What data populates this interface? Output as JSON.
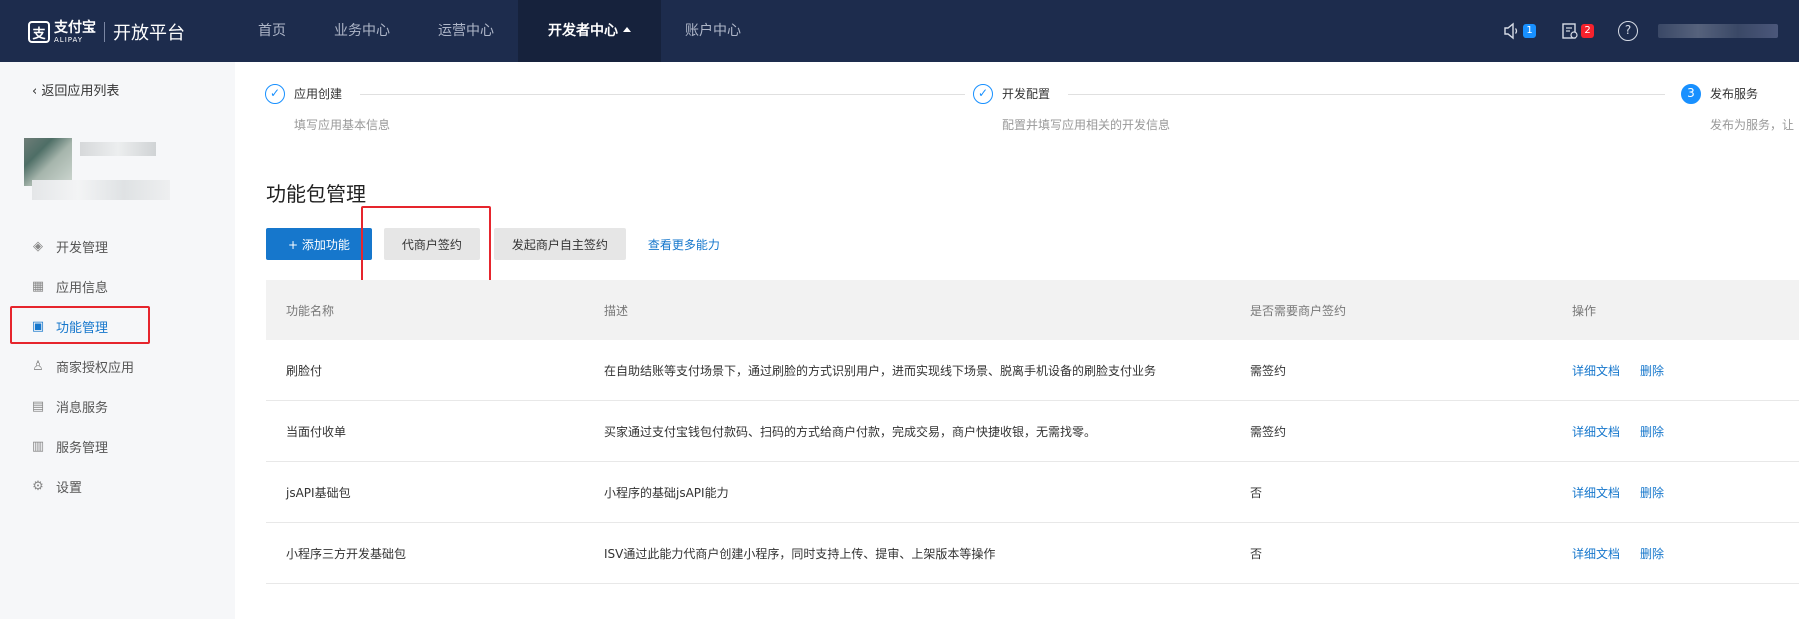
{
  "topbar": {
    "logo_mark": "支",
    "logo_cn": "支付宝",
    "logo_en": "ALIPAY",
    "platform_title": "开放平台",
    "nav": [
      {
        "label": "首页"
      },
      {
        "label": "业务中心"
      },
      {
        "label": "运营中心"
      },
      {
        "label": "开发者中心"
      },
      {
        "label": "账户中心"
      }
    ],
    "notifications_count": "1",
    "messages_count": "2",
    "help_glyph": "?"
  },
  "sidebar": {
    "back_label": "返回应用列表",
    "menu": [
      {
        "label": "开发管理",
        "icon": "layers-icon"
      },
      {
        "label": "应用信息",
        "icon": "grid-icon"
      },
      {
        "label": "功能管理",
        "icon": "package-icon"
      },
      {
        "label": "商家授权应用",
        "icon": "user-icon"
      },
      {
        "label": "消息服务",
        "icon": "chart-icon"
      },
      {
        "label": "服务管理",
        "icon": "service-icon"
      },
      {
        "label": "设置",
        "icon": "gear-icon"
      }
    ]
  },
  "steps": [
    {
      "title": "应用创建",
      "desc": "填写应用基本信息",
      "status": "done"
    },
    {
      "title": "开发配置",
      "desc": "配置并填写应用相关的开发信息",
      "status": "done"
    },
    {
      "number": "3",
      "title": "发布服务",
      "desc": "发布为服务，让",
      "status": "current"
    }
  ],
  "page_title": "功能包管理",
  "actions": {
    "add_label": "+ 添加功能",
    "proxy_sign_label": "代商户签约",
    "self_sign_label": "发起商户自主签约",
    "more_label": "查看更多能力"
  },
  "table": {
    "headers": [
      "功能名称",
      "描述",
      "是否需要商户签约",
      "操作"
    ],
    "rows": [
      {
        "name": "刷脸付",
        "desc": "在自助结账等支付场景下，通过刷脸的方式识别用户，进而实现线下场景、脱离手机设备的刷脸支付业务",
        "sign": "需签约",
        "doc": "详细文档",
        "del": "删除"
      },
      {
        "name": "当面付收单",
        "desc": "买家通过支付宝钱包付款码、扫码的方式给商户付款，完成交易，商户快捷收银，无需找零。",
        "sign": "需签约",
        "doc": "详细文档",
        "del": "删除"
      },
      {
        "name": "jsAPI基础包",
        "desc": "小程序的基础jsAPI能力",
        "sign": "否",
        "doc": "详细文档",
        "del": "删除"
      },
      {
        "name": "小程序三方开发基础包",
        "desc": "ISV通过此能力代商户创建小程序，同时支持上传、提审、上架版本等操作",
        "sign": "否",
        "doc": "详细文档",
        "del": "删除"
      }
    ]
  },
  "colors": {
    "topbar": "#1d2c4d",
    "accent": "#1677cc",
    "highlight": "#e6252d"
  }
}
